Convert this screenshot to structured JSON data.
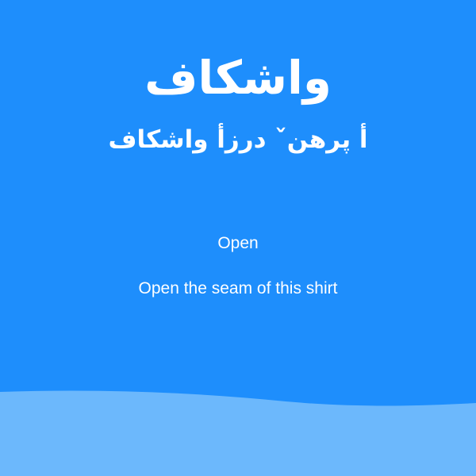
{
  "card": {
    "word": "واشکاف",
    "phrase": "أ پرهنˇ درزأ واشکاف",
    "gloss": "Open",
    "sentence": "Open the seam of this shirt"
  },
  "colors": {
    "background": "#1E8EFC",
    "wave": "#6CB8FC",
    "text": "#FFFFFF"
  }
}
